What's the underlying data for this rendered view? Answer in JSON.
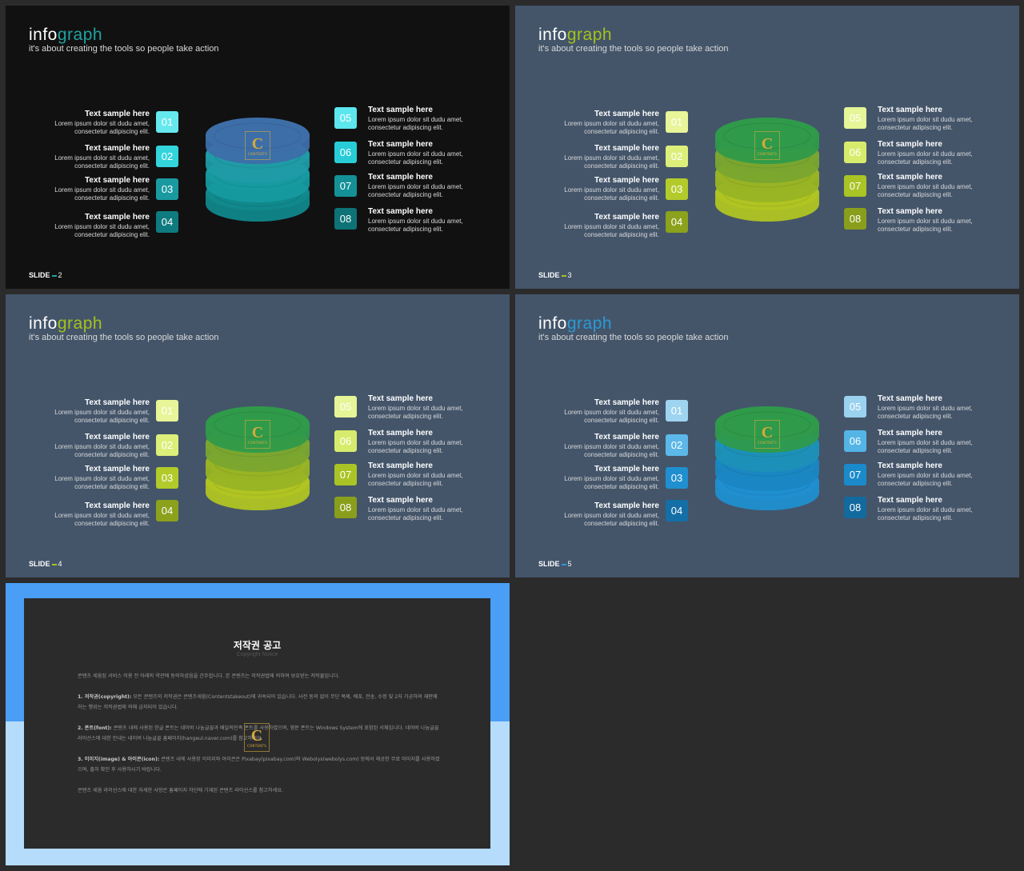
{
  "common": {
    "title_a": "info",
    "title_b": "graph",
    "subtitle": "it's about creating the tools so people take action",
    "item_heading": "Text sample here",
    "item_line1": "Lorem ipsum dolor sit dudu amet,",
    "item_line2": "consectetur adipiscing elit.",
    "slide_label": "SLIDE",
    "logo_letter": "C",
    "logo_text": "CONTENTS"
  },
  "slides": [
    {
      "num": "2",
      "bg": "#111111",
      "accent": "#22a2a2",
      "badges": [
        {
          "label": "01",
          "bg": "#66e8ef",
          "fg": "#ffffff"
        },
        {
          "label": "02",
          "bg": "#33d4dc",
          "fg": "#ffffff"
        },
        {
          "label": "03",
          "bg": "#1a9aa0",
          "fg": "#ffffff"
        },
        {
          "label": "04",
          "bg": "#0f7b80",
          "fg": "#ffffff"
        },
        {
          "label": "05",
          "bg": "#5ce6ee",
          "fg": "#ffffff"
        },
        {
          "label": "06",
          "bg": "#28ccd6",
          "fg": "#ffffff"
        },
        {
          "label": "07",
          "bg": "#149196",
          "fg": "#ffffff"
        },
        {
          "label": "08",
          "bg": "#0d7377",
          "fg": "#ffffff"
        }
      ],
      "rings": [
        "#3d6ea8",
        "#1f9ba6",
        "#169aa0",
        "#10888c"
      ]
    },
    {
      "num": "3",
      "bg": "#44556a",
      "accent": "#a4c21c",
      "badges": [
        {
          "label": "01",
          "bg": "#e8f598",
          "fg": "#ffffff"
        },
        {
          "label": "02",
          "bg": "#dcef7a",
          "fg": "#ffffff"
        },
        {
          "label": "03",
          "bg": "#b3cb2a",
          "fg": "#ffffff"
        },
        {
          "label": "04",
          "bg": "#8ca11c",
          "fg": "#ffffff"
        },
        {
          "label": "05",
          "bg": "#e6f597",
          "fg": "#ffffff"
        },
        {
          "label": "06",
          "bg": "#d7ec6c",
          "fg": "#ffffff"
        },
        {
          "label": "07",
          "bg": "#aac425",
          "fg": "#ffffff"
        },
        {
          "label": "08",
          "bg": "#899e1a",
          "fg": "#ffffff"
        }
      ],
      "rings": [
        "#2f9a4a",
        "#7aa630",
        "#98b424",
        "#b0c422"
      ]
    },
    {
      "num": "4",
      "bg": "#44556a",
      "accent": "#a4c21c",
      "badges": [
        {
          "label": "01",
          "bg": "#e8f598",
          "fg": "#ffffff"
        },
        {
          "label": "02",
          "bg": "#dcef7a",
          "fg": "#ffffff"
        },
        {
          "label": "03",
          "bg": "#b3cb2a",
          "fg": "#ffffff"
        },
        {
          "label": "04",
          "bg": "#8ca11c",
          "fg": "#ffffff"
        },
        {
          "label": "05",
          "bg": "#e6f597",
          "fg": "#ffffff"
        },
        {
          "label": "06",
          "bg": "#d7ec6c",
          "fg": "#ffffff"
        },
        {
          "label": "07",
          "bg": "#aac425",
          "fg": "#ffffff"
        },
        {
          "label": "08",
          "bg": "#899e1a",
          "fg": "#ffffff"
        }
      ],
      "rings": [
        "#2f9a4a",
        "#7aa630",
        "#98b424",
        "#b0c422"
      ]
    },
    {
      "num": "5",
      "bg": "#44556a",
      "accent": "#2a9ad6",
      "badges": [
        {
          "label": "01",
          "bg": "#9fd4f0",
          "fg": "#ffffff"
        },
        {
          "label": "02",
          "bg": "#5cb8e8",
          "fg": "#ffffff"
        },
        {
          "label": "03",
          "bg": "#1f8fd0",
          "fg": "#ffffff"
        },
        {
          "label": "04",
          "bg": "#146fa6",
          "fg": "#ffffff"
        },
        {
          "label": "05",
          "bg": "#9ad2ef",
          "fg": "#ffffff"
        },
        {
          "label": "06",
          "bg": "#55b4e6",
          "fg": "#ffffff"
        },
        {
          "label": "07",
          "bg": "#1a8acb",
          "fg": "#ffffff"
        },
        {
          "label": "08",
          "bg": "#126a9e",
          "fg": "#ffffff"
        }
      ],
      "rings": [
        "#2f9a4a",
        "#1d90b8",
        "#1a86c2",
        "#1f8fd0"
      ]
    }
  ],
  "notice": {
    "title": "저작권 공고",
    "subtitle": "Copyright Notice",
    "p0": "콘텐츠 세움집 서비스 이용 전 아래의 약관에 동의하셨음을 간주합니다. 본 콘텐츠는 저작권법에 의하여 보호받는 저작물입니다.",
    "p1_head": "1. 저작권(copyright):",
    "p1": "모든 콘텐츠의 저작권은 콘텐츠세움(Contentstakeout)에 귀속되어 있습니다. 사전 동의 없이 무단 복제, 배포, 전송, 수정 및 2차 가공하여 재판매하는 행위는 저작권법에 의해 금지되어 있습니다.",
    "p2_head": "2. 폰트(font):",
    "p2": "콘텐츠 내에 사용된 한글 폰트는 네이버 나눔글꼴과 배달의민족 폰트를 사용하였으며, 영문 폰트는 Windows System에 포함된 서체입니다. 네이버 나눔글꼴 라이선스에 대한 안내는 네이버 나눔글꼴 홈페이지(hangeul.naver.com)를 참고하세요.",
    "p3_head": "3. 이미지(image) & 아이콘(icon):",
    "p3": "콘텐츠 내에 사용된 이미지와 아이콘은 Pixabay(pixabay.com)와 Webolys(webolys.com) 등에서 제공한 무료 이미지를 사용하였으며, 출처 확인 후 사용하시기 바랍니다.",
    "p4": "콘텐츠 세움 라이선스에 대한 자세한 사항은 홈페이지 하단에 기재된 콘텐츠 라이선스를 참고하세요."
  }
}
